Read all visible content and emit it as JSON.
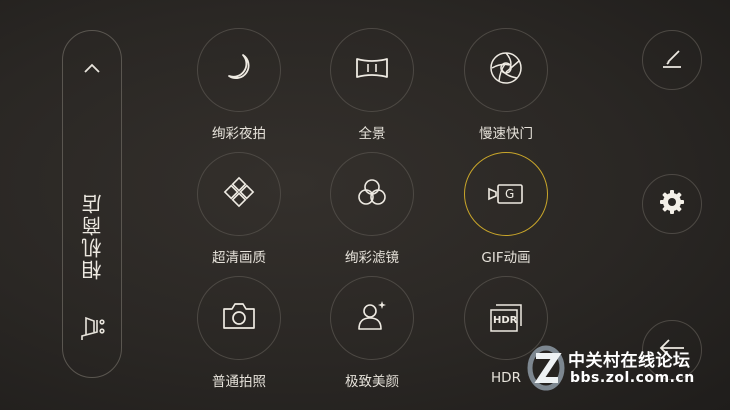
{
  "store": {
    "title": "相机商店",
    "up_icon": "chevron-up-icon",
    "cart_icon": "shopping-cart-icon"
  },
  "modes": [
    {
      "label": "绚彩夜拍",
      "icon": "moon-icon",
      "active": false
    },
    {
      "label": "全景",
      "icon": "panorama-icon",
      "active": false
    },
    {
      "label": "慢速快门",
      "icon": "shutter-icon",
      "active": false
    },
    {
      "label": "超清画质",
      "icon": "diamond-grid-icon",
      "active": false
    },
    {
      "label": "绚彩滤镜",
      "icon": "filter-circles-icon",
      "active": false
    },
    {
      "label": "GIF动画",
      "icon": "gif-camera-icon",
      "active": true
    },
    {
      "label": "普通拍照",
      "icon": "camera-icon",
      "active": false
    },
    {
      "label": "极致美颜",
      "icon": "beauty-person-icon",
      "active": false
    },
    {
      "label": "HDR",
      "icon": "hdr-icon",
      "active": false
    }
  ],
  "icons": {
    "gif_badge": "G",
    "hdr_badge": "HDR"
  },
  "side_buttons": [
    {
      "icon": "edit-icon"
    },
    {
      "icon": "gear-icon"
    },
    {
      "icon": "back-arrow-icon"
    }
  ],
  "watermark": {
    "line1": "中关村在线论坛",
    "line2": "bbs.zol.com.cn"
  },
  "colors": {
    "background": "#2a2724",
    "accent_ring": "#c9a62a",
    "ring": "#4d4944",
    "text": "#e6e2da"
  }
}
